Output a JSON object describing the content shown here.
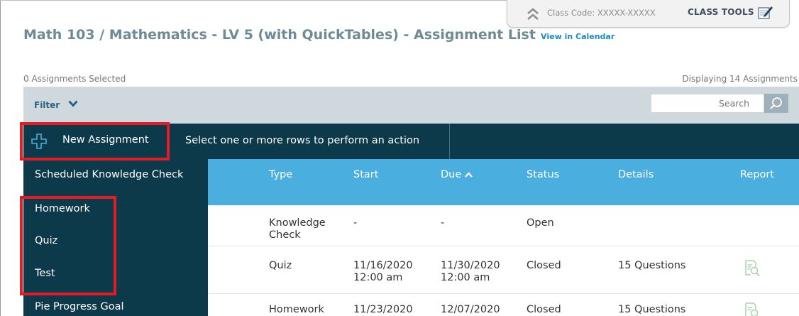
{
  "class_tab": {
    "class_code": "Class Code: XXXXX-XXXXX",
    "class_tools_label": "CLASS TOOLS"
  },
  "page": {
    "title": "Math 103 / Mathematics - LV 5 (with QuickTables) - Assignment List",
    "view_in_calendar": "View in Calendar",
    "selected_count": "0 Assignments Selected",
    "displaying": "Displaying 14 Assignments"
  },
  "filter": {
    "label": "Filter",
    "search_placeholder": "Search"
  },
  "action_bar": {
    "new_assignment_label": "New Assignment",
    "hint": "Select one or more rows to perform an action"
  },
  "columns": {
    "type": "Type",
    "start": "Start",
    "due": "Due",
    "status": "Status",
    "details": "Details",
    "report": "Report"
  },
  "rows": [
    {
      "name_fragment": "ck",
      "type": [
        "Knowledge",
        "Check"
      ],
      "start": [
        "-",
        ""
      ],
      "due": [
        "-",
        ""
      ],
      "status": "Open",
      "details": ""
    },
    {
      "name_fragment": "",
      "type": [
        "Quiz",
        ""
      ],
      "start": [
        "11/16/2020",
        "12:00 am"
      ],
      "due": [
        "11/30/2020",
        "12:00 am"
      ],
      "status": "Closed",
      "details": "15 Questions"
    },
    {
      "name_fragment": "",
      "type": [
        "Homework",
        ""
      ],
      "start": [
        "11/23/2020",
        ""
      ],
      "due": [
        "12/07/2020",
        ""
      ],
      "status": "Closed",
      "details": "15 Questions"
    }
  ],
  "dropdown_items": [
    "Scheduled Knowledge Check",
    "Homework",
    "Quiz",
    "Test",
    "Pie Progress Goal"
  ],
  "colors": {
    "title": "#6d8a97",
    "dark_navy": "#0d3a4a",
    "header_blue": "#4aafdf",
    "filter_bar": "#cfd9dd",
    "highlight_red": "#e21b24",
    "link_blue": "#1d7fb3"
  },
  "icons": {
    "collapse": "double-chevron-up-icon",
    "class_tools": "pencil-notepad-icon",
    "filter": "chevron-down-icon",
    "search": "magnifier-icon",
    "new_assignment": "plus-outline-icon",
    "sort": "chevron-up-icon",
    "report": "report-magnifier-icon"
  }
}
